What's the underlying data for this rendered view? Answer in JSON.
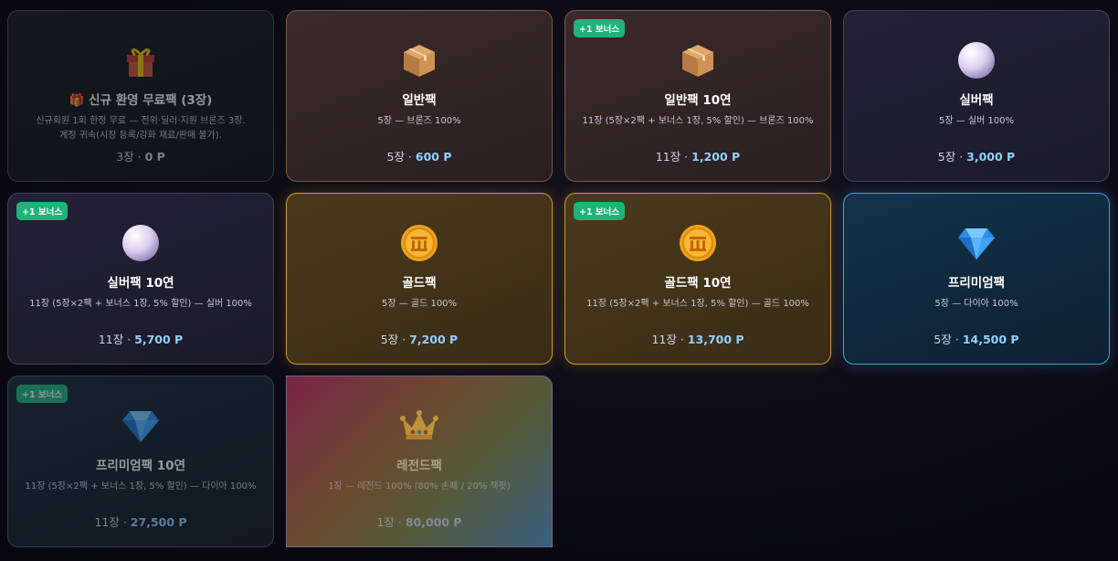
{
  "packs": [
    {
      "title": "🎁 신규 환영 무료팩 (3장)",
      "desc": "신규회원 1회 한정 무료 — 전위·딜러·지원 브론즈 3장.\n계정 귀속(시장 등록/강화 재료/판매 불가).",
      "count": "3장 ·",
      "price": "0 P",
      "icon": "gift-icon",
      "badge": ""
    },
    {
      "title": "일반팩",
      "desc": "5장 — 브론즈 100%",
      "count": "5장 ·",
      "price": "600 P",
      "icon": "package-icon",
      "badge": ""
    },
    {
      "title": "일반팩 10연",
      "desc": "11장 (5장×2팩 + 보너스 1장, 5% 할인) — 브론즈 100%",
      "count": "11장 ·",
      "price": "1,200 P",
      "icon": "package-icon",
      "badge": "+1 보너스"
    },
    {
      "title": "실버팩",
      "desc": "5장 — 실버 100%",
      "count": "5장 ·",
      "price": "3,000 P",
      "icon": "pearl-icon",
      "badge": ""
    },
    {
      "title": "실버팩 10연",
      "desc": "11장 (5장×2팩 + 보너스 1장, 5% 할인) — 실버 100%",
      "count": "11장 ·",
      "price": "5,700 P",
      "icon": "pearl-icon",
      "badge": "+1 보너스"
    },
    {
      "title": "골드팩",
      "desc": "5장 — 골드 100%",
      "count": "5장 ·",
      "price": "7,200 P",
      "icon": "gold-coin-icon",
      "badge": ""
    },
    {
      "title": "골드팩 10연",
      "desc": "11장 (5장×2팩 + 보너스 1장, 5% 할인) — 골드 100%",
      "count": "11장 ·",
      "price": "13,700 P",
      "icon": "gold-coin-icon",
      "badge": "+1 보너스"
    },
    {
      "title": "프리미엄팩",
      "desc": "5장 — 다이아 100%",
      "count": "5장 ·",
      "price": "14,500 P",
      "icon": "diamond-icon",
      "badge": ""
    },
    {
      "title": "프리미엄팩 10연",
      "desc": "11장 (5장×2팩 + 보너스 1장, 5% 할인) — 다이아 100%",
      "count": "11장 ·",
      "price": "27,500 P",
      "icon": "diamond-icon",
      "badge": "+1 보너스"
    },
    {
      "title": "레전드팩",
      "desc": "1장 — 레전드 100% (80% 손패 / 20% 잭팟)",
      "count": "1장 ·",
      "price": "80,000 P",
      "icon": "crown-icon",
      "badge": ""
    }
  ]
}
